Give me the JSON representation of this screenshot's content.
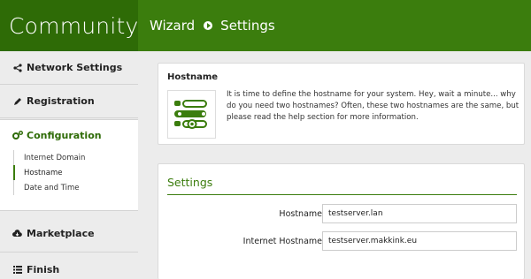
{
  "header": {
    "brand": "Community",
    "breadcrumb": [
      "Wizard",
      "Settings"
    ],
    "brand_color": "#2e6b06",
    "bar_color": "#3b7d0d"
  },
  "sidebar": {
    "items": [
      {
        "label": "Network Settings",
        "icon": "share-icon"
      },
      {
        "label": "Registration",
        "icon": "pencil-icon"
      },
      {
        "label": "Configuration",
        "icon": "gears-icon",
        "active": true,
        "subitems": [
          {
            "label": "Internet Domain"
          },
          {
            "label": "Hostname",
            "active": true
          },
          {
            "label": "Date and Time"
          }
        ]
      },
      {
        "label": "Marketplace",
        "icon": "cloud-download-icon"
      },
      {
        "label": "Finish",
        "icon": "list-icon"
      }
    ]
  },
  "intro_panel": {
    "title": "Hostname",
    "description": "It is time to define the hostname for your system. Hey, wait a minute... why do you need two hostnames? Often, these two hostnames are the same, but please read the help section for more information.",
    "illustration_icon": "hostname-toggle-illustration-icon"
  },
  "settings_panel": {
    "title": "Settings",
    "fields": [
      {
        "label": "Hostname",
        "value": "testserver.lan"
      },
      {
        "label": "Internet Hostname",
        "value": "testserver.makkink.eu"
      }
    ]
  }
}
